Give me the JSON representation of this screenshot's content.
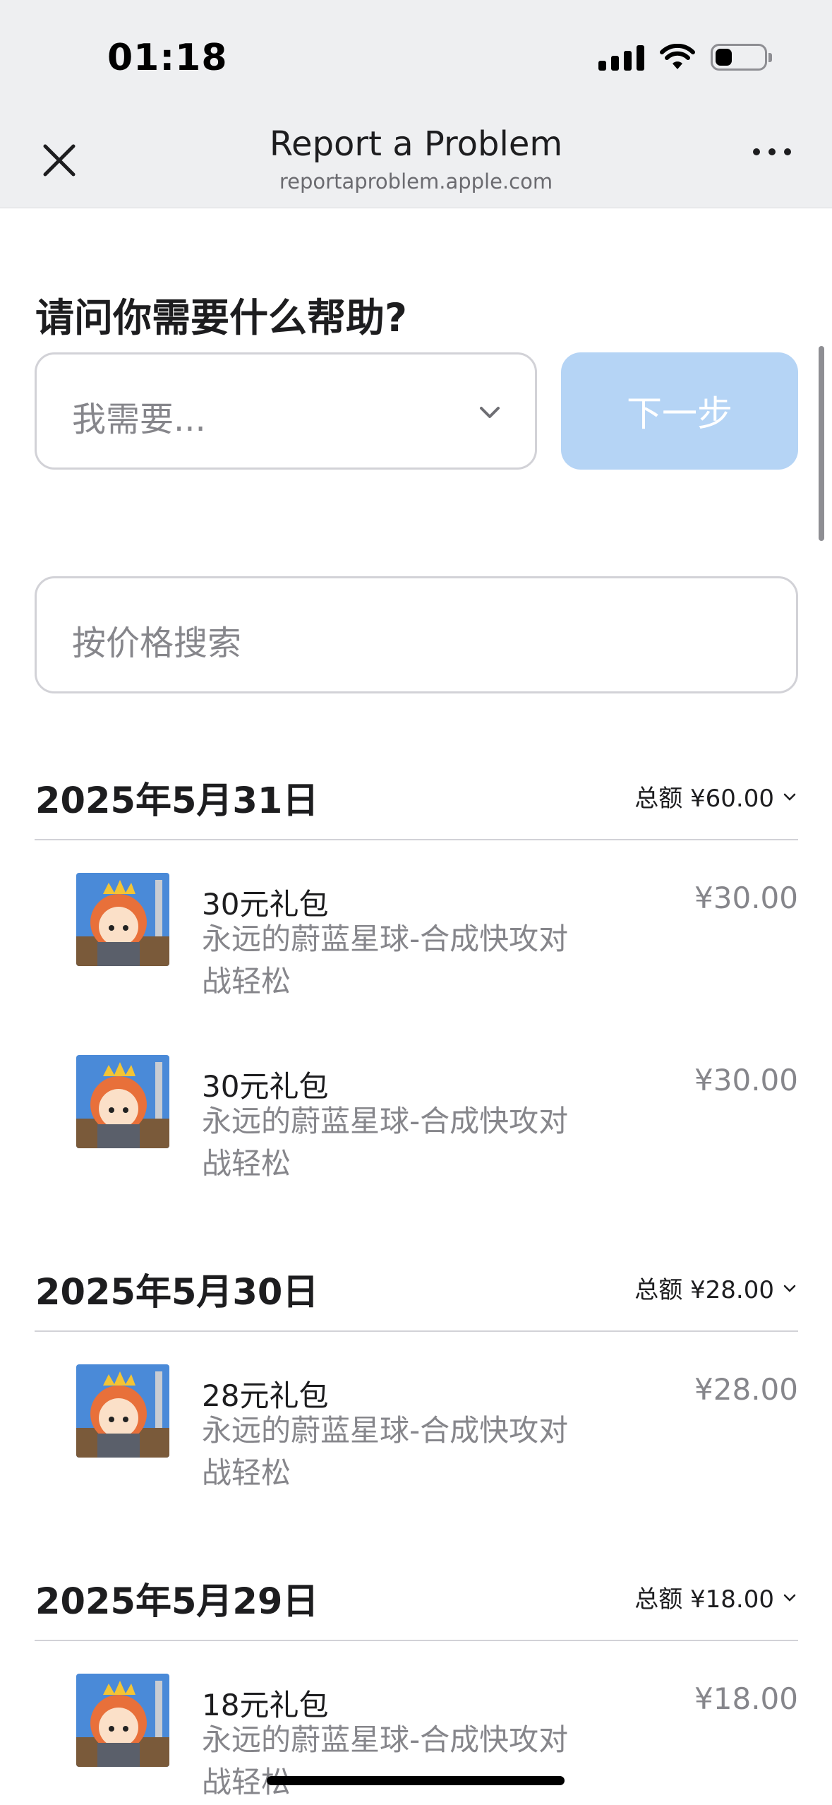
{
  "status_bar": {
    "time": "01:18",
    "battery_level_percent": 35
  },
  "nav": {
    "title": "Report a Problem",
    "subtitle": "reportaproblem.apple.com",
    "close_icon": "close-icon",
    "more_icon": "more-icon"
  },
  "help": {
    "heading": "请问你需要什么帮助?",
    "select_placeholder": "我需要...",
    "next_label": "下一步"
  },
  "search": {
    "placeholder": "按价格搜索"
  },
  "groups": [
    {
      "date": "2025年5月31日",
      "total": "总额 ¥60.00",
      "items": [
        {
          "name": "30元礼包",
          "desc": "永远的蔚蓝星球-合成快攻对战轻松",
          "price": "¥30.00"
        },
        {
          "name": "30元礼包",
          "desc": "永远的蔚蓝星球-合成快攻对战轻松",
          "price": "¥30.00"
        }
      ]
    },
    {
      "date": "2025年5月30日",
      "total": "总额 ¥28.00",
      "items": [
        {
          "name": "28元礼包",
          "desc": "永远的蔚蓝星球-合成快攻对战轻松",
          "price": "¥28.00"
        }
      ]
    },
    {
      "date": "2025年5月29日",
      "total": "总额 ¥18.00",
      "items": [
        {
          "name": "18元礼包",
          "desc": "永远的蔚蓝星球-合成快攻对战轻松",
          "price": "¥18.00"
        }
      ]
    }
  ],
  "colors": {
    "accent_disabled": "#b5d4f5",
    "chrome_bg": "#eeeff1",
    "secondary_text": "#86868b"
  }
}
